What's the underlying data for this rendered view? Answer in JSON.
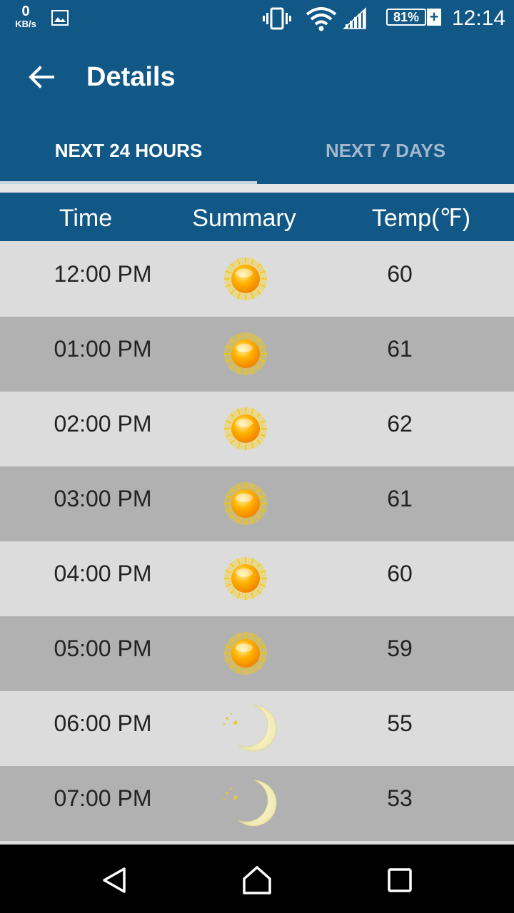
{
  "status_bar": {
    "speed_value": "0",
    "speed_unit": "KB/s",
    "battery": "81%",
    "battery_plus": "+",
    "time": "12:14",
    "icons": [
      "image-icon",
      "vibrate-icon",
      "wifi-icon",
      "signal-icon",
      "battery-icon"
    ]
  },
  "app_bar": {
    "title": "Details",
    "back_icon": "arrow-left-icon",
    "color": "#125887"
  },
  "tabs": [
    {
      "label": "NEXT 24 HOURS",
      "selected": true
    },
    {
      "label": "NEXT 7 DAYS",
      "selected": false
    }
  ],
  "table": {
    "headers": {
      "time": "Time",
      "summary": "Summary",
      "temp": "Temp(℉)"
    },
    "rows": [
      {
        "time": "12:00 PM",
        "icon": "sun-icon",
        "temp": "60"
      },
      {
        "time": "01:00 PM",
        "icon": "sun-icon",
        "temp": "61"
      },
      {
        "time": "02:00 PM",
        "icon": "sun-icon",
        "temp": "62"
      },
      {
        "time": "03:00 PM",
        "icon": "sun-icon",
        "temp": "61"
      },
      {
        "time": "04:00 PM",
        "icon": "sun-icon",
        "temp": "60"
      },
      {
        "time": "05:00 PM",
        "icon": "sun-icon",
        "temp": "59"
      },
      {
        "time": "06:00 PM",
        "icon": "moon-icon",
        "temp": "55"
      },
      {
        "time": "07:00 PM",
        "icon": "moon-icon",
        "temp": "53"
      }
    ]
  },
  "nav_bar": {
    "icons": [
      "nav-back-icon",
      "nav-home-icon",
      "nav-recent-icon"
    ]
  }
}
